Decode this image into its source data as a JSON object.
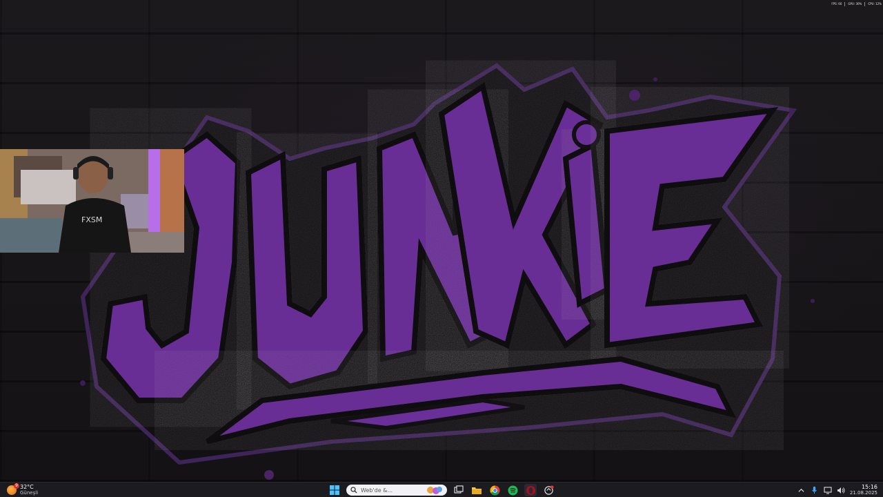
{
  "overlay_stats": [
    "FPS: 60",
    "GPU: 30%",
    "CPU: 12%"
  ],
  "wallpaper": {
    "text": "JUNKIE",
    "colors": {
      "fill": "#6a2f98",
      "outline": "#4a2466",
      "background": "#161416"
    }
  },
  "webcam": {
    "shirt_text": "FXSM"
  },
  "taskbar": {
    "weather": {
      "badge": "9",
      "temperature": "32°C",
      "condition": "Güneşli"
    },
    "search": {
      "placeholder": "Web'de &..."
    },
    "apps": [
      {
        "name": "start",
        "icon": "windows-icon"
      },
      {
        "name": "search"
      },
      {
        "name": "task-view",
        "icon": "task-view-icon"
      },
      {
        "name": "file-explorer",
        "icon": "folder-icon"
      },
      {
        "name": "chrome",
        "icon": "chrome-icon"
      },
      {
        "name": "spotify",
        "icon": "spotify-icon"
      },
      {
        "name": "opera",
        "icon": "opera-icon"
      },
      {
        "name": "app",
        "icon": "app-icon"
      }
    ],
    "tray": {
      "time": "15:16",
      "date": "21.08.2025"
    }
  }
}
